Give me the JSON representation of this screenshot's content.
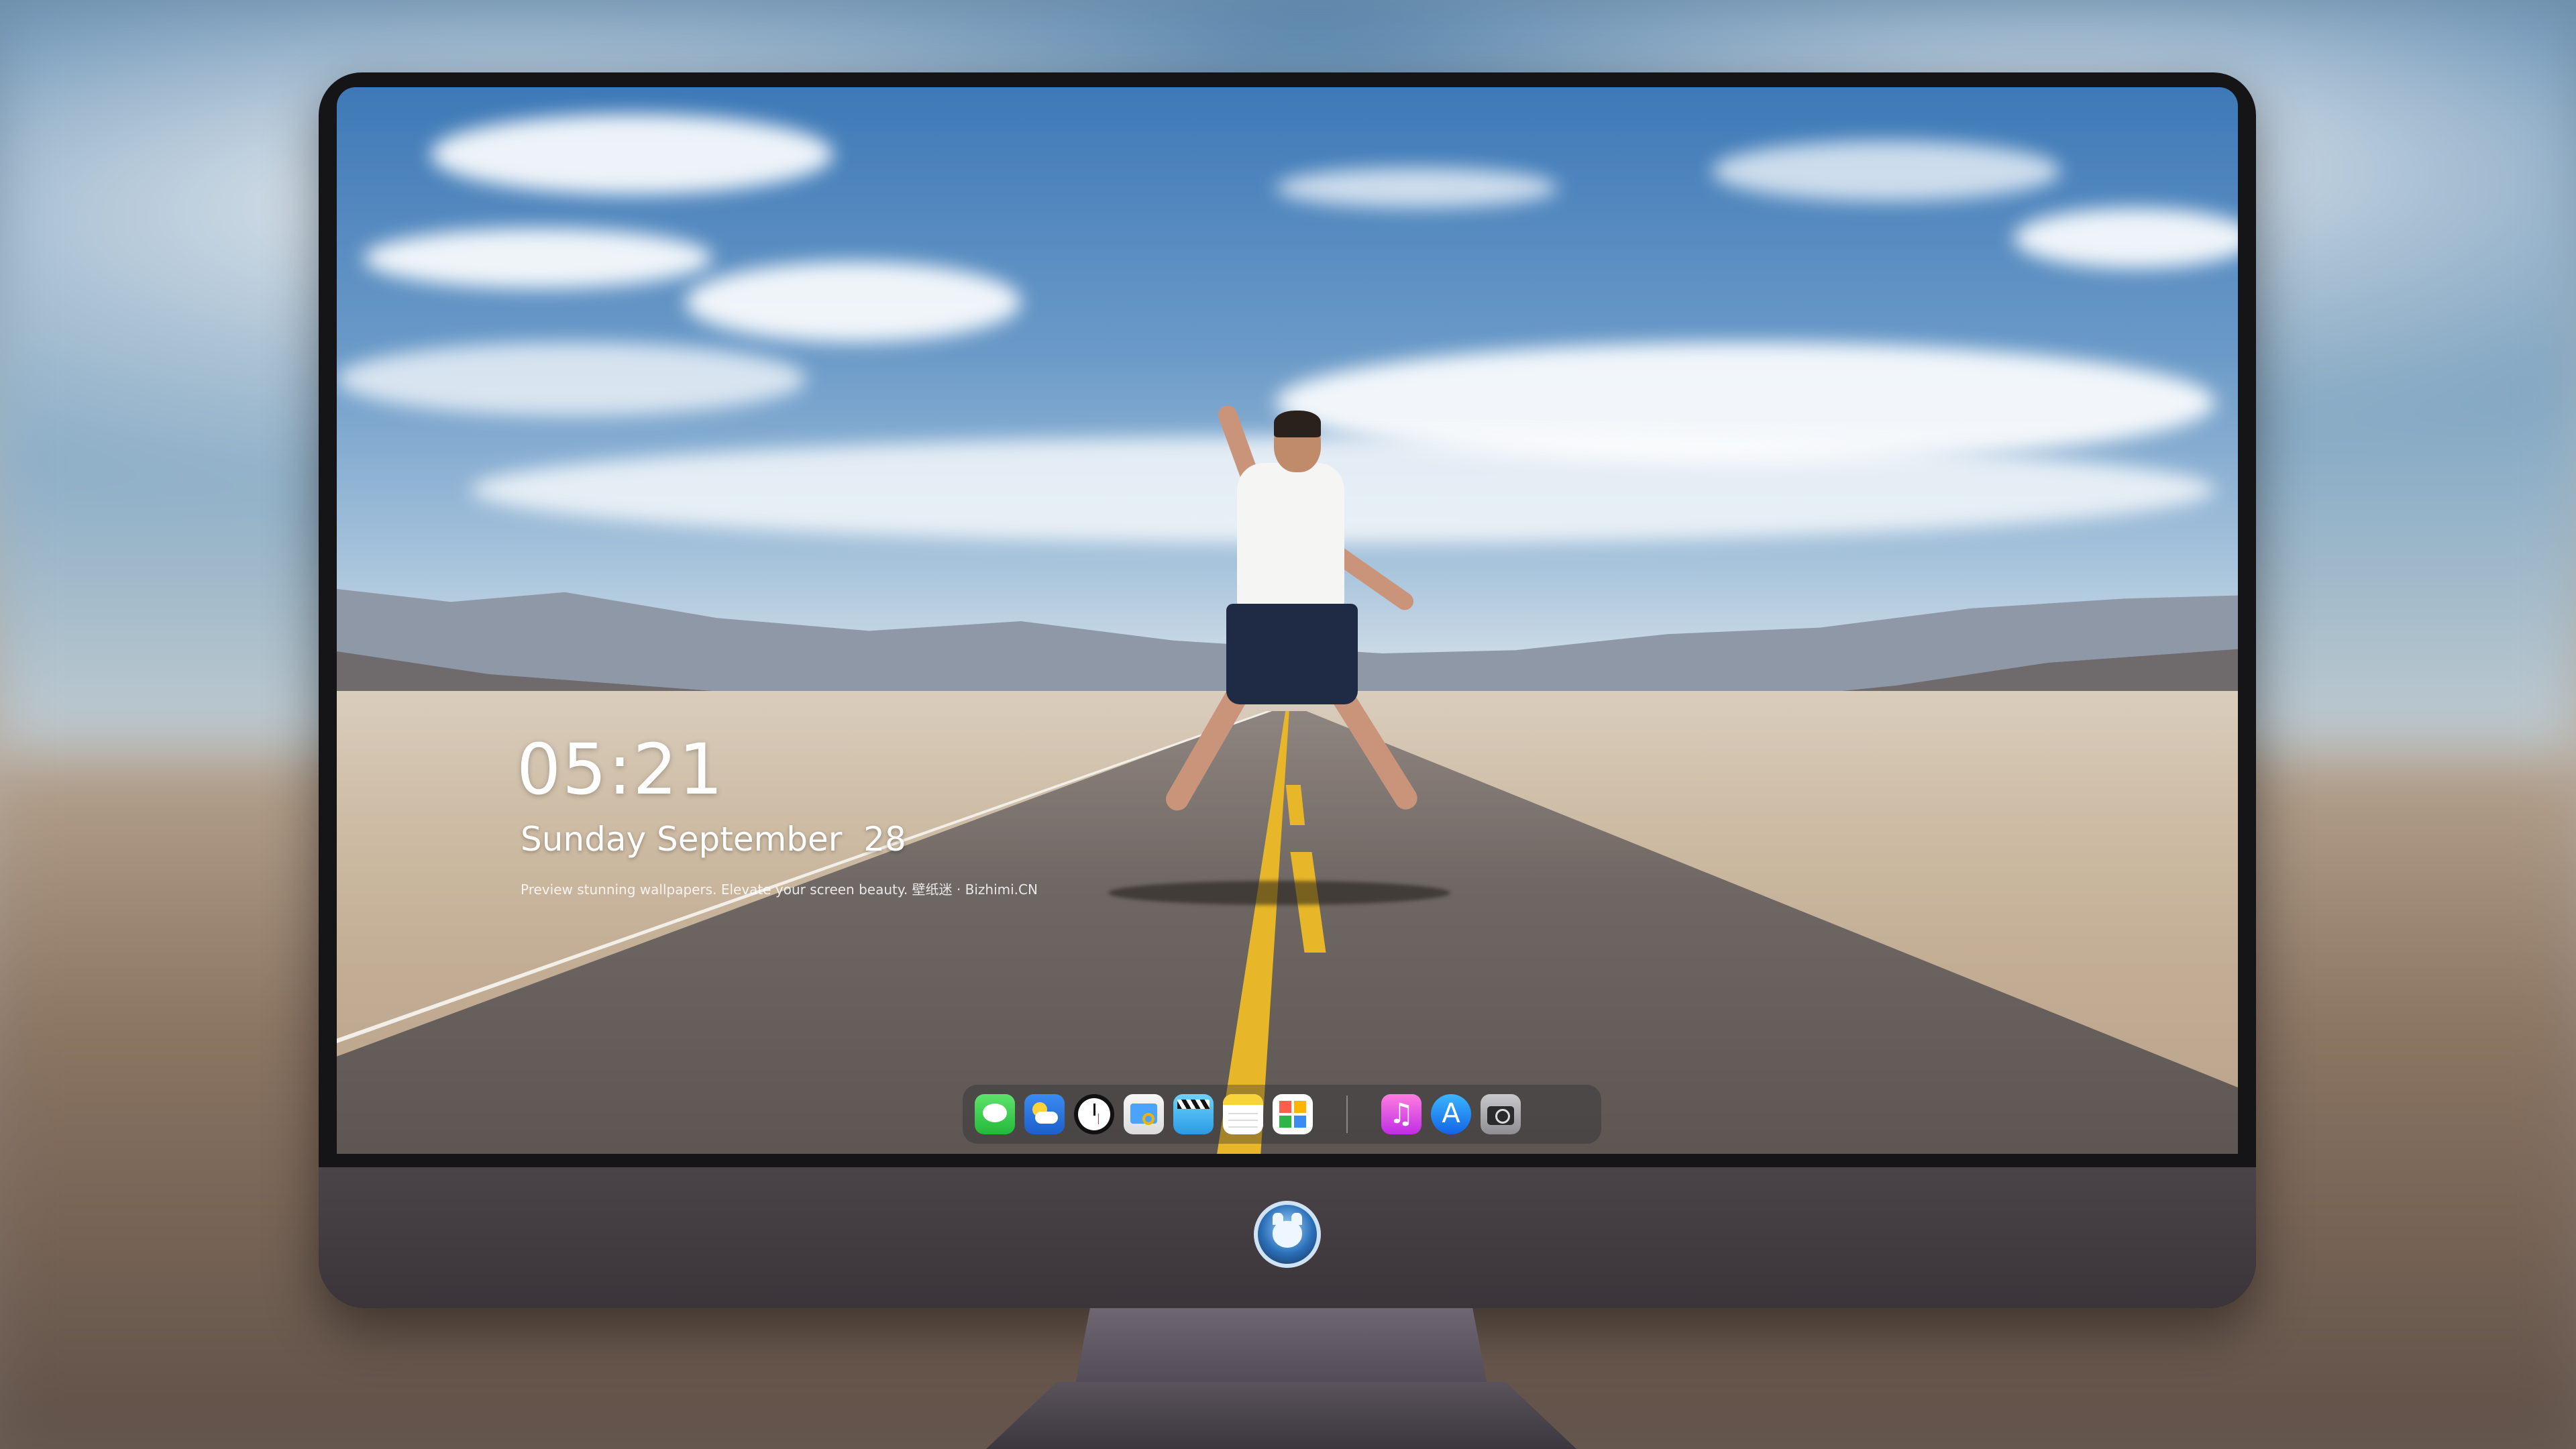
{
  "lockscreen": {
    "time": "05:21",
    "date": "Sunday September  28",
    "caption": "Preview stunning wallpapers. Elevate your screen beauty. 壁纸迷 · Bizhimi.CN"
  },
  "dock": {
    "apps": [
      {
        "name": "Messages",
        "icon": "messages-icon"
      },
      {
        "name": "Weather",
        "icon": "weather-icon"
      },
      {
        "name": "Clock",
        "icon": "clock-icon"
      },
      {
        "name": "Preview",
        "icon": "preview-icon"
      },
      {
        "name": "Clips",
        "icon": "clips-icon"
      },
      {
        "name": "Notes",
        "icon": "notes-icon"
      },
      {
        "name": "Photo Booth",
        "icon": "photos-icon"
      },
      {
        "name": "Music",
        "icon": "music-icon"
      },
      {
        "name": "App Store",
        "icon": "app-store-icon"
      },
      {
        "name": "Camera",
        "icon": "camera-icon"
      }
    ]
  },
  "monitor": {
    "logo": "kitten-mascot-logo"
  },
  "colors": {
    "bezel": "#151517",
    "chin": "#3e383d",
    "road_line": "#e7b629",
    "sky": "#3e79b7"
  }
}
